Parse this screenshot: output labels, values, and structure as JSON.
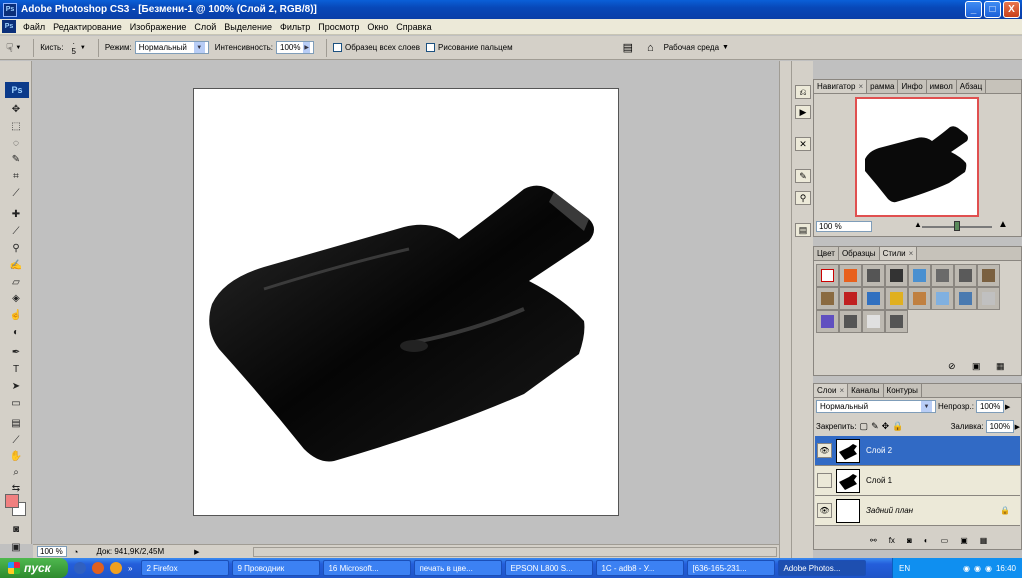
{
  "window": {
    "title": "Adobe Photoshop CS3 - [Безмени-1 @ 100% (Слой 2, RGB/8)]",
    "app_icon": "Ps",
    "buttons": [
      "_",
      "□",
      "X"
    ]
  },
  "menubar": {
    "badge": "Ps",
    "items": [
      "Файл",
      "Редактирование",
      "Изображение",
      "Слой",
      "Выделение",
      "Фильтр",
      "Просмотр",
      "Окно",
      "Справка"
    ]
  },
  "options": {
    "brush_label": "Кисть:",
    "brush_size": "5",
    "mode_label": "Режим:",
    "mode_value": "Нормальный",
    "strength_label": "Интенсивность:",
    "strength_value": "100%",
    "sample_all_label": "Образец всех слоев",
    "finger_paint_label": "Рисование пальцем",
    "workspace_label": "Рабочая среда"
  },
  "toolbox": {
    "ps_logo": "Ps",
    "tools": [
      "move-icon",
      "marquee-icon",
      "lasso-icon",
      "quick-select-icon",
      "crop-icon",
      "slice-icon",
      "healing-icon",
      "brush-icon",
      "stamp-icon",
      "history-brush-icon",
      "eraser-icon",
      "gradient-icon",
      "smudge-icon",
      "dodge-icon",
      "pen-icon",
      "type-icon",
      "path-select-icon",
      "shape-icon",
      "notes-icon",
      "eyedropper-icon",
      "hand-icon",
      "zoom-icon"
    ],
    "fg_color": "#f08080",
    "bg_color": "#ffffff"
  },
  "status": {
    "zoom": "100 %",
    "doc": "Док: 941,9K/2,45M"
  },
  "navigator": {
    "tabs": [
      "Навигатор",
      "рамма",
      "Инфо",
      "имвол",
      "Абзац"
    ],
    "zoom": "100 %"
  },
  "styles_panel": {
    "tabs": [
      "Цвет",
      "Образцы",
      "Стили"
    ],
    "swatches": [
      "#ffffff",
      "#e8601c",
      "#555555",
      "#333333",
      "#4a90d0",
      "#6a6a6a",
      "#5a5a5a",
      "#7a6040",
      "#8a6a40",
      "#c02020",
      "#3070c0",
      "#e0b020",
      "#c08040",
      "#80b0e0",
      "#4a7ab0",
      "#c0c0c0",
      "#6050c0",
      "#555555",
      "#e0e0e0",
      "#555555"
    ]
  },
  "layers_panel": {
    "tabs": [
      "Слои",
      "Каналы",
      "Контуры"
    ],
    "blend_mode": "Нормальный",
    "opacity_label": "Непрозр.:",
    "opacity_value": "100%",
    "lock_label": "Закрепить:",
    "fill_label": "Заливка:",
    "fill_value": "100%",
    "layers": [
      {
        "name": "Слой 2",
        "active": true,
        "visible": true
      },
      {
        "name": "Слой 1",
        "active": false,
        "visible": false
      },
      {
        "name": "Задний план",
        "active": false,
        "visible": true
      }
    ]
  },
  "taskbar": {
    "start_label": "пуск",
    "tasks": [
      "2 Firefox",
      "9 Проводник",
      "16 Microsoft...",
      "печать в цве...",
      "EPSON L800 S...",
      "1С - adb8 - У...",
      "[636-165-231...",
      "Adobe Photos..."
    ],
    "lang": "EN",
    "clock": "16:40"
  }
}
